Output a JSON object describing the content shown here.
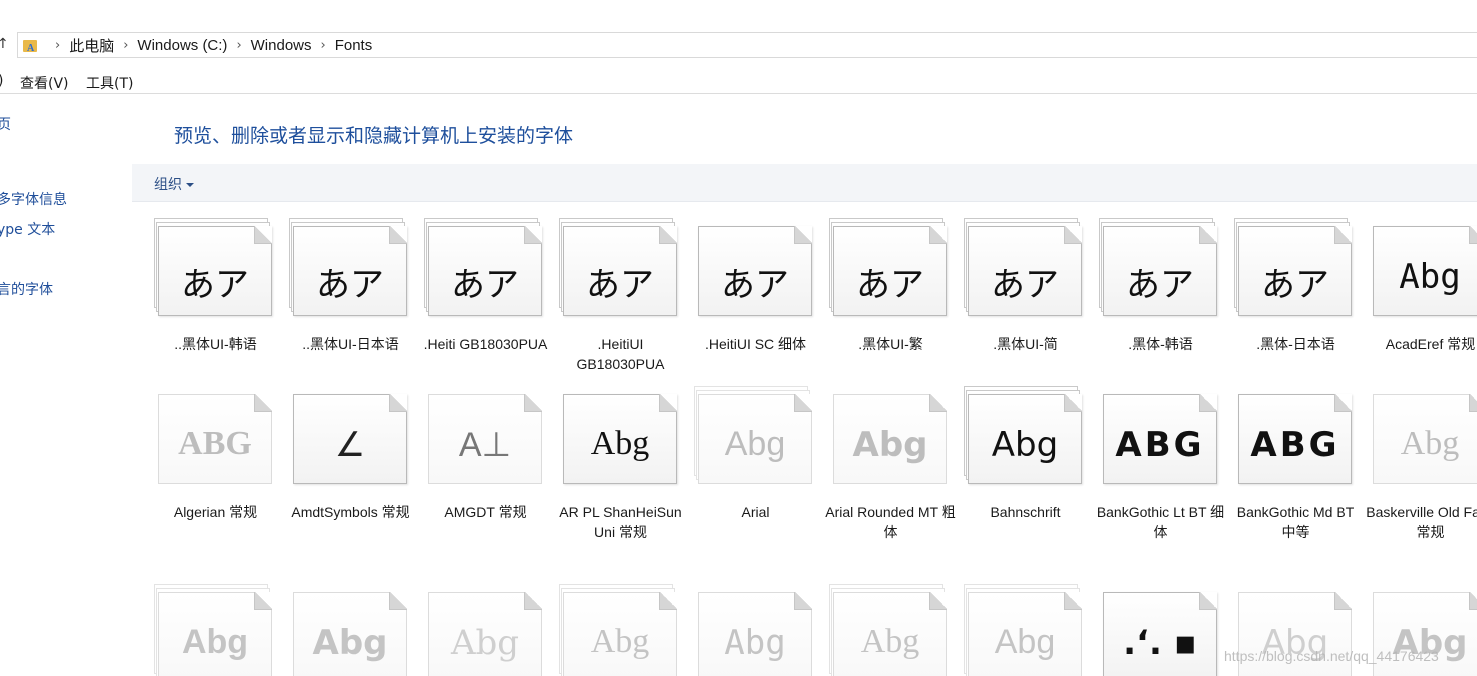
{
  "address_bar": {
    "up_icon": "up-arrow-icon",
    "folder_icon": "font-folder-icon",
    "crumbs": [
      "此电脑",
      "Windows (C:)",
      "Windows",
      "Fonts"
    ]
  },
  "menu": {
    "items": [
      ")",
      "查看(V)",
      "工具(T)"
    ]
  },
  "left_pane": {
    "links": [
      "页",
      "多字体信息",
      "ype 文本",
      "言的字体"
    ]
  },
  "main": {
    "title": "预览、删除或者显示和隐藏计算机上安装的字体",
    "organize_label": "组织",
    "organize_icon": "caret-down-icon"
  },
  "fonts": [
    {
      "sample": "あア",
      "label": "..黑体UI-韩语"
    },
    {
      "sample": "あア",
      "label": "..黑体UI-日本语"
    },
    {
      "sample": "あア",
      "label": ".Heiti GB18030PUA"
    },
    {
      "sample": "あア",
      "label": ".HeitiUI GB18030PUA"
    },
    {
      "sample": "あア",
      "label": ".HeitiUI SC 细体"
    },
    {
      "sample": "あア",
      "label": ".黑体UI-繁"
    },
    {
      "sample": "あア",
      "label": ".黑体UI-简"
    },
    {
      "sample": "あア",
      "label": ".黑体-韩语"
    },
    {
      "sample": "あア",
      "label": ".黑体-日本语"
    },
    {
      "sample": "Abg",
      "label": "AcadEref 常规"
    },
    {
      "sample": "ABG",
      "label": "Algerian 常规"
    },
    {
      "sample": "∠",
      "label": "AmdtSymbols 常规"
    },
    {
      "sample": "A⊥",
      "label": "AMGDT 常规"
    },
    {
      "sample": "Abg",
      "label": "AR PL ShanHeiSun Uni 常规"
    },
    {
      "sample": "Abg",
      "label": "Arial"
    },
    {
      "sample": "Abg",
      "label": "Arial Rounded MT 粗体"
    },
    {
      "sample": "Abg",
      "label": "Bahnschrift"
    },
    {
      "sample": "ABG",
      "label": "BankGothic Lt BT 细体"
    },
    {
      "sample": "ABG",
      "label": "BankGothic Md BT 中等"
    },
    {
      "sample": "Abg",
      "label": "Baskerville Old Face 常规"
    },
    {
      "sample": "Abg",
      "label": ""
    },
    {
      "sample": "Abg",
      "label": ""
    },
    {
      "sample": "Abg",
      "label": ""
    },
    {
      "sample": "Abg",
      "label": ""
    },
    {
      "sample": "Abg",
      "label": ""
    },
    {
      "sample": "Abg",
      "label": ""
    },
    {
      "sample": "Abg",
      "label": ""
    },
    {
      "sample": ".‘. ▪",
      "label": ""
    },
    {
      "sample": "Abg",
      "label": ""
    },
    {
      "sample": "Abg",
      "label": ""
    }
  ],
  "watermark": "https://blog.csdn.net/qq_44176423"
}
